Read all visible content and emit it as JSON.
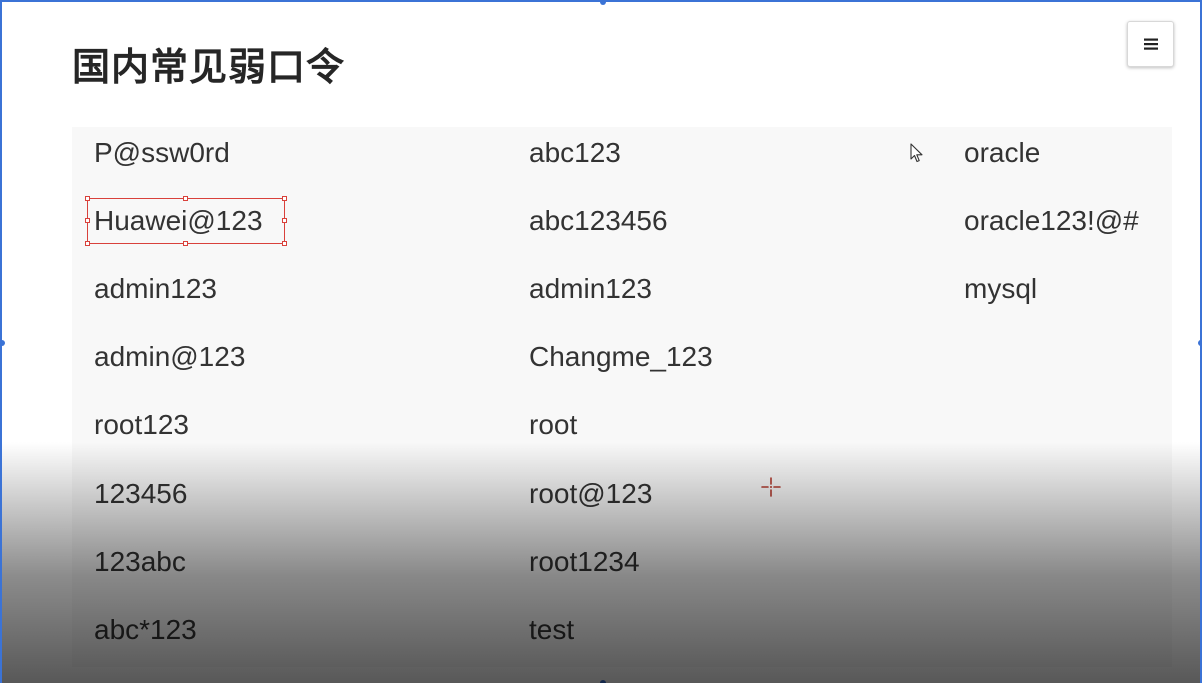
{
  "slide": {
    "title": "国内常见弱口令",
    "menu_icon": "hamburger-menu-icon"
  },
  "passwords": {
    "columns": [
      [
        "P@ssw0rd",
        "Huawei@123",
        "admin123",
        "admin@123",
        "root123",
        "123456",
        "123abc",
        "abc*123"
      ],
      [
        "abc123",
        "abc123456",
        "admin123",
        "Changme_123",
        "root",
        "root@123",
        "root1234",
        "test"
      ],
      [
        "oracle",
        "oracle123!@#",
        "mysql"
      ]
    ],
    "selected_cell": "Huawei@123"
  },
  "colors": {
    "selection_border": "#3b73d6",
    "highlight_box": "#d9413b",
    "text": "#333333"
  }
}
